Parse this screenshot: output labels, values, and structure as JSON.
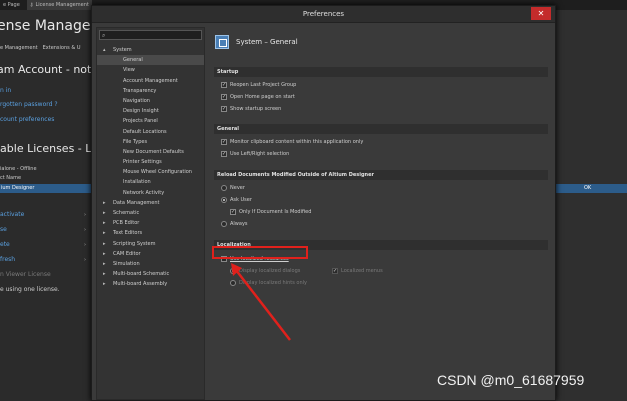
{
  "top_tabs": [
    "e Page",
    "License Management"
  ],
  "background": {
    "title": "ense Managem",
    "crumbs": [
      "e Management",
      "Extensions & U"
    ],
    "account": "am Account - not sig",
    "links": [
      "n in",
      "rgotten password ?",
      "count preferences"
    ],
    "licenses_title": "lable Licenses - Lice",
    "rows": [
      "ialone - Offline",
      "ct Name"
    ],
    "selected_row": "ium Designer",
    "ok_label": "OK",
    "actions": [
      "activate",
      "se",
      "ete",
      "fresh",
      "n Viewer License"
    ],
    "note": "e using one license."
  },
  "dialog": {
    "title": "Preferences",
    "close_label": "✕",
    "tree": [
      {
        "label": "System",
        "level": 0,
        "expanded": true
      },
      {
        "label": "General",
        "level": 1,
        "selected": true
      },
      {
        "label": "View",
        "level": 1
      },
      {
        "label": "Account Management",
        "level": 1
      },
      {
        "label": "Transparency",
        "level": 1
      },
      {
        "label": "Navigation",
        "level": 1
      },
      {
        "label": "Design Insight",
        "level": 1
      },
      {
        "label": "Projects Panel",
        "level": 1
      },
      {
        "label": "Default Locations",
        "level": 1
      },
      {
        "label": "File Types",
        "level": 1
      },
      {
        "label": "New Document Defaults",
        "level": 1
      },
      {
        "label": "Printer Settings",
        "level": 1
      },
      {
        "label": "Mouse Wheel Configuration",
        "level": 1
      },
      {
        "label": "Installation",
        "level": 1
      },
      {
        "label": "Network Activity",
        "level": 1
      },
      {
        "label": "Data Management",
        "level": 0
      },
      {
        "label": "Schematic",
        "level": 0
      },
      {
        "label": "PCB Editor",
        "level": 0
      },
      {
        "label": "Text Editors",
        "level": 0
      },
      {
        "label": "Scripting System",
        "level": 0
      },
      {
        "label": "CAM Editor",
        "level": 0
      },
      {
        "label": "Simulation",
        "level": 0
      },
      {
        "label": "Multi-board Schematic",
        "level": 0
      },
      {
        "label": "Multi-board Assembly",
        "level": 0
      }
    ],
    "header": "System – General",
    "sections": {
      "startup": "Startup",
      "general": "General",
      "reload": "Reload Documents Modified Outside of Altium Designer",
      "localization": "Localization"
    },
    "startup_options": [
      "Reopen Last Project Group",
      "Open Home page on start",
      "Show startup screen"
    ],
    "general_options": [
      "Monitor clipboard content within this application only",
      "Use Left/Right selection"
    ],
    "reload_options": [
      "Never",
      "Ask User",
      "Only If Document Is Modified",
      "Always"
    ],
    "localization_options": {
      "use_localized": "Use localized resources",
      "dialogs": "Display localized dialogs",
      "menus": "Localized menus",
      "hints": "Display localized hints only"
    }
  },
  "watermark": "CSDN @m0_61687959"
}
